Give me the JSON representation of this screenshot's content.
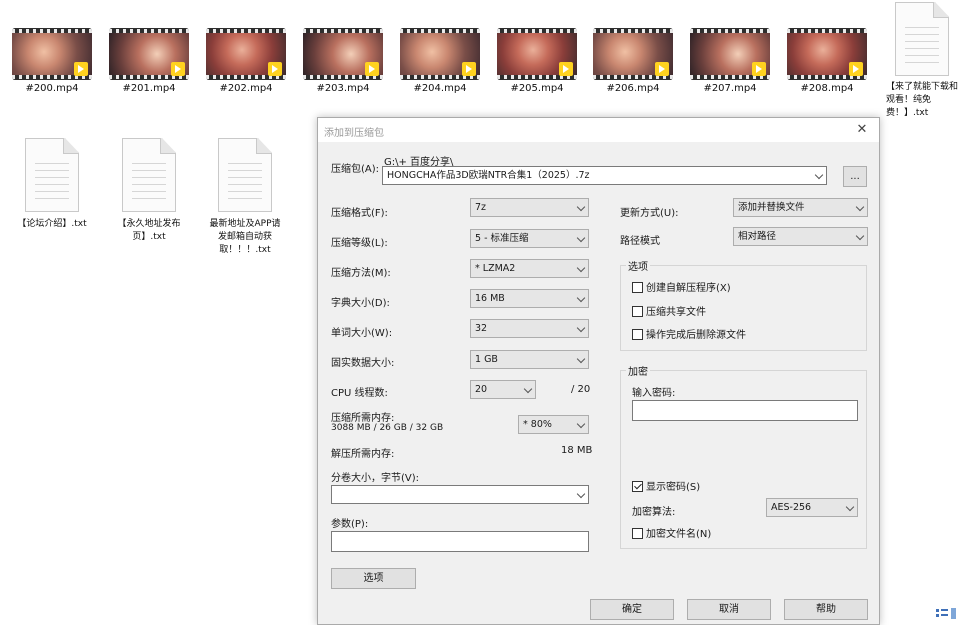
{
  "videos": [
    "#200.mp4",
    "#201.mp4",
    "#202.mp4",
    "#203.mp4",
    "#204.mp4",
    "#205.mp4",
    "#206.mp4",
    "#207.mp4",
    "#208.mp4"
  ],
  "video_badge": "Player",
  "text_files": [
    "【来了就能下载和观看！纯免费！】.txt",
    "【论坛介绍】.txt",
    "【永久地址发布页】.txt",
    "最新地址及APP请发邮箱自动获取！！！.txt"
  ],
  "dialog": {
    "title": "添加到压缩包",
    "close_glyph": "✕",
    "archive": {
      "label": "压缩包(A):",
      "path": "G:\\+ 百度分享\\",
      "value": "HONGCHA作品3D欧瑞NTR合集1（2025）.7z",
      "browse": "..."
    },
    "left": {
      "format": {
        "label": "压缩格式(F):",
        "value": "7z"
      },
      "level": {
        "label": "压缩等级(L):",
        "value": "5 - 标准压缩"
      },
      "method": {
        "label": "压缩方法(M):",
        "value": "* LZMA2"
      },
      "dict": {
        "label": "字典大小(D):",
        "value": "16 MB"
      },
      "word": {
        "label": "单词大小(W):",
        "value": "32"
      },
      "solid": {
        "label": "固实数据大小:",
        "value": "1 GB"
      },
      "cpu": {
        "label": "CPU 线程数:",
        "value": "20",
        "total": "/ 20"
      },
      "mem": {
        "label": "压缩所需内存:",
        "detail": "3088 MB / 26 GB / 32 GB",
        "value": "* 80%"
      },
      "decomp": {
        "label": "解压所需内存:",
        "value": "18 MB"
      },
      "split": {
        "label": "分卷大小，字节(V):",
        "value": ""
      },
      "params": {
        "label": "参数(P):",
        "value": ""
      },
      "options_button": "选项"
    },
    "right": {
      "update": {
        "label": "更新方式(U):",
        "value": "添加并替换文件"
      },
      "path_mode": {
        "label": "路径模式",
        "value": "相对路径"
      },
      "options": {
        "title": "选项",
        "sfx": "创建自解压程序(X)",
        "shared": "压缩共享文件",
        "delete_after": "操作完成后删除源文件"
      },
      "encryption": {
        "title": "加密",
        "password_label": "输入密码:",
        "show_password": "显示密码(S)",
        "method_label": "加密算法:",
        "method_value": "AES-256",
        "encrypt_names": "加密文件名(N)"
      }
    },
    "buttons": {
      "ok": "确定",
      "cancel": "取消",
      "help": "帮助"
    }
  }
}
